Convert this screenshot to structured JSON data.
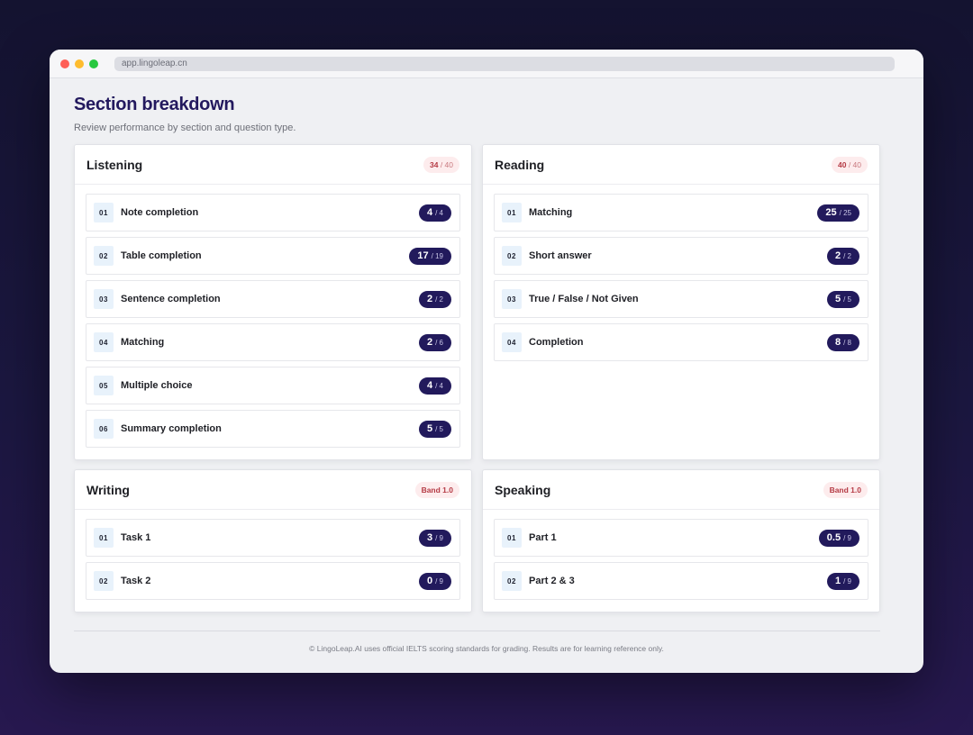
{
  "browser": {
    "url": "app.lingoleap.cn"
  },
  "page": {
    "title": "Section breakdown",
    "subtitle": "Review performance by section and question type."
  },
  "sections": [
    {
      "title": "Listening",
      "score": "34",
      "score_total": "/ 40",
      "items": [
        {
          "num": "01",
          "label": "Note completion",
          "score": "4",
          "total": "/ 4"
        },
        {
          "num": "02",
          "label": "Table completion",
          "score": "17",
          "total": "/ 19"
        },
        {
          "num": "03",
          "label": "Sentence completion",
          "score": "2",
          "total": "/ 2"
        },
        {
          "num": "04",
          "label": "Matching",
          "score": "2",
          "total": "/ 6"
        },
        {
          "num": "05",
          "label": "Multiple choice",
          "score": "4",
          "total": "/ 4"
        },
        {
          "num": "06",
          "label": "Summary completion",
          "score": "5",
          "total": "/ 5"
        }
      ]
    },
    {
      "title": "Reading",
      "score": "40",
      "score_total": "/ 40",
      "items": [
        {
          "num": "01",
          "label": "Matching",
          "score": "25",
          "total": "/ 25"
        },
        {
          "num": "02",
          "label": "Short answer",
          "score": "2",
          "total": "/ 2"
        },
        {
          "num": "03",
          "label": "True / False / Not Given",
          "score": "5",
          "total": "/ 5"
        },
        {
          "num": "04",
          "label": "Completion",
          "score": "8",
          "total": "/ 8"
        }
      ]
    },
    {
      "title": "Writing",
      "score": "Band 1.0",
      "score_total": "",
      "items": [
        {
          "num": "01",
          "label": "Task 1",
          "score": "3",
          "total": "/ 9"
        },
        {
          "num": "02",
          "label": "Task 2",
          "score": "0",
          "total": "/ 9"
        }
      ]
    },
    {
      "title": "Speaking",
      "score": "Band 1.0",
      "score_total": "",
      "items": [
        {
          "num": "01",
          "label": "Part 1",
          "score": "0.5",
          "total": "/ 9"
        },
        {
          "num": "02",
          "label": "Part 2 & 3",
          "score": "1",
          "total": "/ 9"
        }
      ]
    }
  ],
  "footer": {
    "text": "© LingoLeap.AI uses official IELTS scoring standards for grading. Results are for learning reference only."
  },
  "colors": {
    "accent": "#221a5c",
    "title": "#23195e",
    "badge_bg": "#fdeced",
    "badge_text": "#b53b45",
    "num_bg": "#e8f2fb"
  }
}
